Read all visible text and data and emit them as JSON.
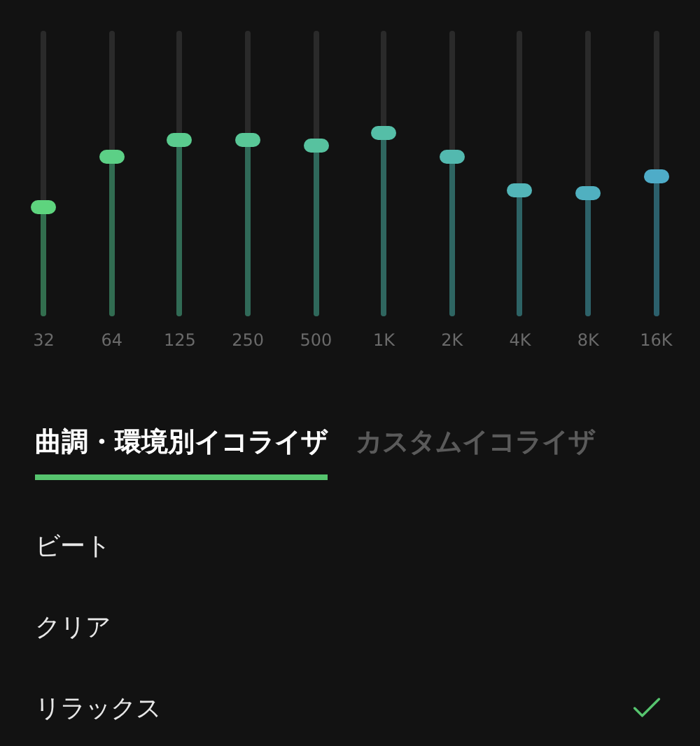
{
  "equalizer": {
    "bands": [
      {
        "label": "32",
        "level": 0.38
      },
      {
        "label": "64",
        "level": 0.56
      },
      {
        "label": "125",
        "level": 0.62
      },
      {
        "label": "250",
        "level": 0.62
      },
      {
        "label": "500",
        "level": 0.6
      },
      {
        "label": "1K",
        "level": 0.64
      },
      {
        "label": "2K",
        "level": 0.56
      },
      {
        "label": "4K",
        "level": 0.44
      },
      {
        "label": "8K",
        "level": 0.43
      },
      {
        "label": "16K",
        "level": 0.49
      }
    ]
  },
  "tabs": [
    {
      "label": "曲調・環境別イコライザ",
      "selected": true
    },
    {
      "label": "カスタムイコライザ",
      "selected": false
    }
  ],
  "presets": [
    {
      "label": "ビート",
      "checked": false
    },
    {
      "label": "クリア",
      "checked": false
    },
    {
      "label": "リラックス",
      "checked": true
    }
  ]
}
